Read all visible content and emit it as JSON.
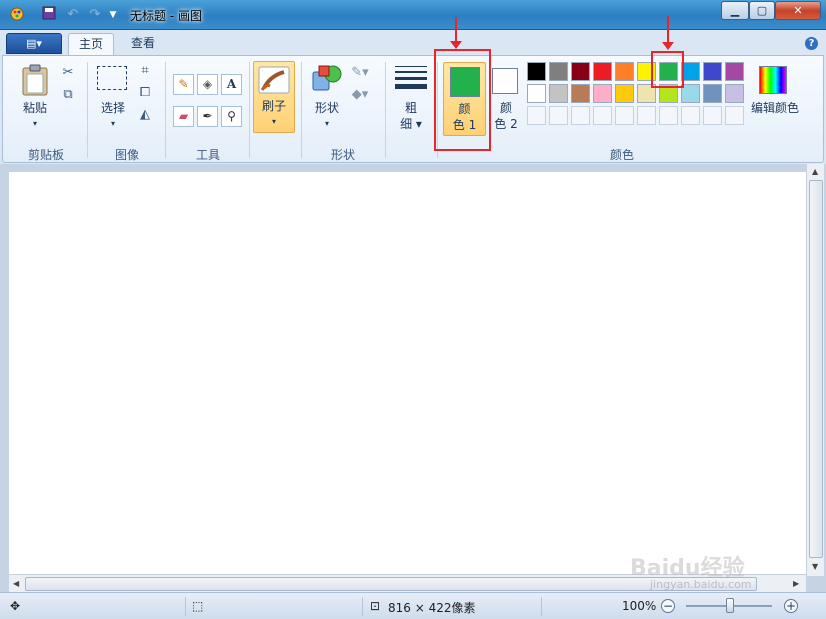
{
  "window": {
    "title": "无标题 - 画图",
    "minimize": "▁",
    "maximize": "▢",
    "close": "✕"
  },
  "tabs": {
    "app_button": "▤▾",
    "home": "主页",
    "view": "查看",
    "help": "?"
  },
  "clipboard": {
    "paste": "粘贴",
    "group": "剪贴板"
  },
  "image": {
    "select": "选择",
    "group": "图像"
  },
  "tools": {
    "group": "工具",
    "text_tool": "A"
  },
  "brushes": {
    "label": "刷子"
  },
  "shapes": {
    "label": "形状",
    "group": "形状"
  },
  "size": {
    "label_line1": "粗",
    "label_line2": "细"
  },
  "colors": {
    "color1_line1": "颜",
    "color1_line2": "色 1",
    "color2_line1": "颜",
    "color2_line2": "色 2",
    "edit_colors": "编辑颜色",
    "group": "颜色",
    "color1_value": "#22b14c",
    "color2_value": "#ffffff",
    "palette_row1": [
      "#000000",
      "#7f7f7f",
      "#880015",
      "#ed1c24",
      "#ff7f27",
      "#fff200",
      "#22b14c",
      "#00a2e8",
      "#3f48cc",
      "#a349a4"
    ],
    "palette_row2": [
      "#ffffff",
      "#c3c3c3",
      "#b97a57",
      "#ffaec9",
      "#ffc90e",
      "#efe4b0",
      "#b5e61d",
      "#99d9ea",
      "#7092be",
      "#c8bfe7"
    ]
  },
  "status": {
    "dimensions": "816 × 422像素",
    "zoom": "100%"
  },
  "watermark": {
    "text": "Baidu经验",
    "sub": "jingyan.baidu.com"
  }
}
